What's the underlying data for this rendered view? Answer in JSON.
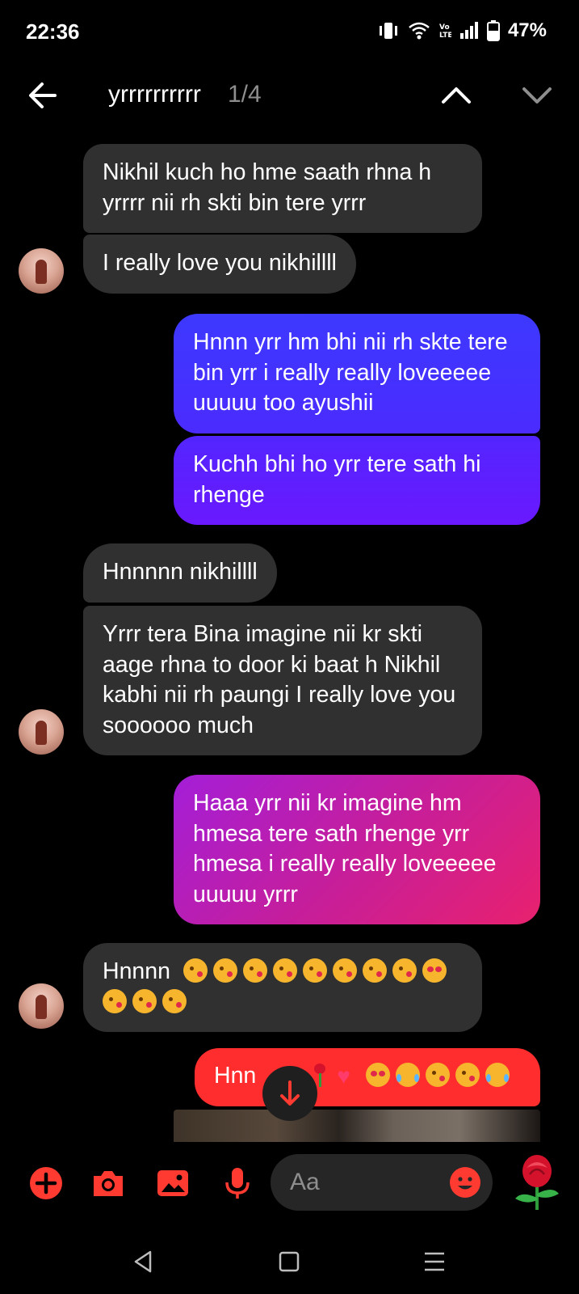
{
  "status_bar": {
    "time": "22:36",
    "battery": "47%",
    "icons": [
      "vibrate-icon",
      "wifi-icon",
      "volte-icon",
      "signal-icon",
      "battery-icon"
    ]
  },
  "header": {
    "search_query": "yrrrrrrrrrr",
    "match_count": "1/4",
    "icons": [
      "back-arrow-icon",
      "chevron-up-icon",
      "chevron-down-icon"
    ]
  },
  "messages": [
    {
      "direction": "in",
      "text": "Nikhil kuch ho hme saath rhna h yrrrr nii rh skti bin tere yrrr"
    },
    {
      "direction": "in",
      "text": "I really love you nikhillll"
    },
    {
      "direction": "out",
      "text": "Hnnn yrr hm bhi nii rh skte tere bin yrr i really really loveeeee uuuuu too ayushii"
    },
    {
      "direction": "out",
      "text": "Kuchh bhi ho yrr tere sath hi rhenge"
    },
    {
      "direction": "in",
      "text": "Hnnnnn nikhillll"
    },
    {
      "direction": "in",
      "text": "Yrrr tera Bina imagine nii kr skti aage rhna to door ki baat h Nikhil kabhi nii rh paungi I really love you soooooo much"
    },
    {
      "direction": "out",
      "text": "Haaa yrr nii kr imagine hm hmesa tere sath rhenge yrr hmesa i really really loveeeee uuuuu yrrr"
    },
    {
      "direction": "in",
      "text": "Hnnnn",
      "emojis": [
        "kiss",
        "kiss",
        "kiss",
        "kiss",
        "kiss",
        "kiss",
        "kiss",
        "kiss",
        "heart-eyes",
        "kiss",
        "kiss",
        "kiss"
      ]
    },
    {
      "direction": "out",
      "text": "Hnn",
      "emojis": [
        "rose",
        "heart",
        "heart-eyes",
        "tears-of-joy",
        "kiss",
        "kiss",
        "tears-of-joy"
      ]
    }
  ],
  "composer": {
    "placeholder": "Aa",
    "icons": [
      "add-icon",
      "camera-icon",
      "gallery-icon",
      "microphone-icon",
      "emoji-icon",
      "rose-icon"
    ]
  },
  "nav_bar": {
    "icons": [
      "back-nav-icon",
      "home-nav-icon",
      "menu-nav-icon"
    ]
  },
  "colors": {
    "incoming_bubble": "#303030",
    "outgoing_gradient_1_top": "#3d39ff",
    "outgoing_gradient_1_bottom": "#5b1dff",
    "outgoing_gradient_2_left": "#a51fd6",
    "outgoing_gradient_2_right": "#e8216e",
    "outgoing_last": "#ff2d2d",
    "accent_icons": "#ff3a30"
  }
}
